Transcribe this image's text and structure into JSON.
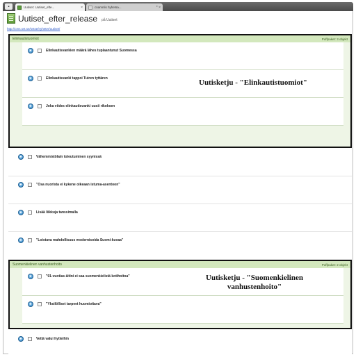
{
  "browser": {
    "menu_icon": "browser-menu-icon",
    "tabs": [
      {
        "label": "Uutiset: Uutiset_efte...",
        "close": "×"
      },
      {
        "label": "cnamnlis hyhetsa...",
        "close": "* ×"
      }
    ]
  },
  "page": {
    "title": "Uutiset_efter_release",
    "title_suffix": "på Uutiset",
    "url": "http://cms.svt.se/svtse/nyheter/uutiset/"
  },
  "groups": [
    {
      "name": "Elinkautistuomiot",
      "count": "Puffpaket: 3 objekt",
      "annotation": "Uutisketju - \"Elinkautistuomiot\"",
      "items": [
        {
          "title": "Elinkautisvankien määrä lähes tuplaantunut Suomessa"
        },
        {
          "title": "Elinkautisvanki tappoi Tuiren tyttären"
        },
        {
          "title": "Joka viides elinkautisvanki uusii rikoksen"
        }
      ]
    },
    {
      "name": "Suomenkielinen vanhustenhoito",
      "count": "Puffpaket: 2 objekt",
      "annotation_line1": "Uutisketju - \"Suomenkielinen",
      "annotation_line2": "vanhustenhoito\"",
      "items": [
        {
          "title": "\"91-vuotias äitini ei saa suomenkielistä kotihoitoa\""
        },
        {
          "title": "\"Yksilölliset tarpeet huomioitava\""
        }
      ]
    }
  ],
  "items": [
    {
      "title": "Vähemmistölain toteutuminen syynissä"
    },
    {
      "title": "\"Osa nuorista ei kykene oikeaan istuma-asentoon\""
    },
    {
      "title": "Lisää liikkuja tanssimalla"
    },
    {
      "title": "\"Loistava mahdollisuus modernisoida Suomi-kuvaa\""
    },
    {
      "title": "Vettä valui hytteihin"
    }
  ],
  "colors": {
    "group_header": "#d3e8bd",
    "group_border": "#111111",
    "link": "#2a57c9"
  }
}
